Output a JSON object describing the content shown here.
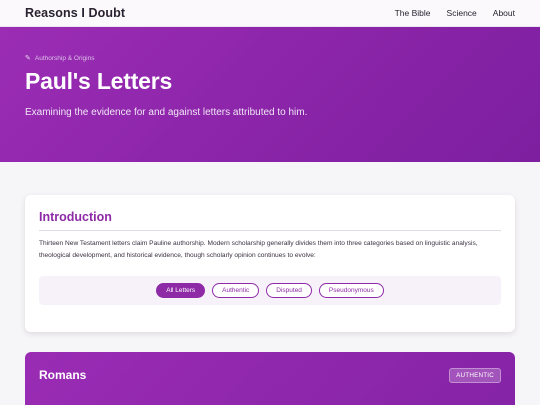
{
  "nav": {
    "brand": "Reasons I Doubt",
    "links": [
      "The Bible",
      "Science",
      "About"
    ]
  },
  "hero": {
    "breadcrumb": "Authorship & Origins",
    "title": "Paul's Letters",
    "subtitle": "Examining the evidence for and against letters attributed to him."
  },
  "intro": {
    "heading": "Introduction",
    "text": "Thirteen New Testament letters claim Pauline authorship. Modern scholarship generally divides them into three categories based on linguistic analysis, theological development, and historical evidence, though scholarly opinion continues to evolve:",
    "filters": [
      "All Letters",
      "Authentic",
      "Disputed",
      "Pseudonymous"
    ],
    "active_filter": "All Letters"
  },
  "letter": {
    "title": "Romans",
    "badge": "AUTHENTIC"
  },
  "colors": {
    "accent": "#8e2aa6",
    "hero_start": "#9b2db5",
    "hero_end": "#7d1fa0",
    "page_bg": "#f6f5f7"
  },
  "icons": {
    "breadcrumb": "pencil-icon"
  }
}
